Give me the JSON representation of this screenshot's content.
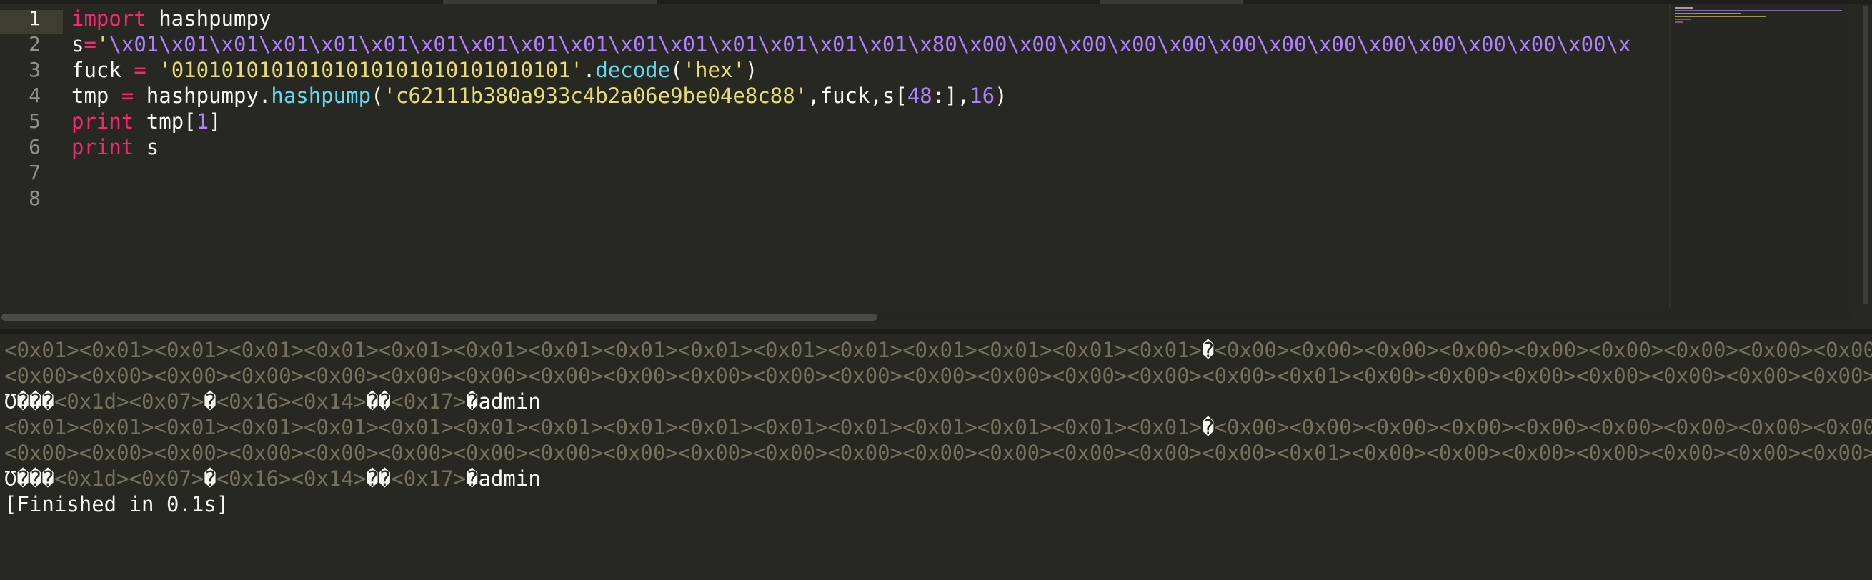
{
  "editor": {
    "line_numbers": [
      "1",
      "2",
      "3",
      "4",
      "5",
      "6",
      "7",
      "8"
    ],
    "line1": {
      "kw": "import",
      "rest": " hashpumpy"
    },
    "line2": {
      "lhs": "s",
      "eq": "=",
      "quote": "'",
      "esc": "\\x01\\x01\\x01\\x01\\x01\\x01\\x01\\x01\\x01\\x01\\x01\\x01\\x01\\x01\\x01\\x01\\x80\\x00\\x00\\x00\\x00\\x00\\x00\\x00\\x00\\x00\\x00\\x00\\x00\\x00\\x"
    },
    "line3": {
      "lhs": "fuck ",
      "eq": "=",
      "sp": " ",
      "str": "'01010101010101010101010101010101'",
      "dot": ".",
      "fn": "decode",
      "open": "(",
      "arg": "'hex'",
      "close": ")"
    },
    "line4": {
      "lhs": "tmp ",
      "eq": "=",
      "mid": " hashpumpy.",
      "fn": "hashpump",
      "open": "(",
      "arg1": "'c62111b380a933c4b2a06e9be04e8c88'",
      "sep": ",fuck,s[",
      "num1": "48",
      "sep2": ":],",
      "num2": "16",
      "close": ")"
    },
    "line5": {
      "kw": "print",
      "rest": " tmp[",
      "num": "1",
      "close": "]"
    },
    "line6": {
      "kw": "print",
      "rest": " s"
    }
  },
  "output": {
    "row1": {
      "a": "<0x01><0x01><0x01><0x01><0x01><0x01><0x01><0x01><0x01><0x01><0x01><0x01><0x01><0x01><0x01><0x01>",
      "b": "�",
      "c": "<0x00><0x00><0x00><0x00><0x00><0x00><0x00><0x00><0x00>"
    },
    "row2": {
      "a": "<0x00><0x00><0x00><0x00><0x00><0x00><0x00><0x00><0x00><0x00><0x00><0x00><0x00><0x00><0x00><0x00><0x00><0x01><0x00><0x00><0x00><0x00><0x00><0x00><0x00><0x14>",
      "b": "�"
    },
    "row3": {
      "a": "Ʊ���",
      "b": "<0x1d><0x07>",
      "c": "�",
      "d": "<0x16><0x14>",
      "e": "��",
      "f": "<0x17>",
      "g": "�",
      "h": "admin"
    },
    "row4": {
      "a": "<0x01><0x01><0x01><0x01><0x01><0x01><0x01><0x01><0x01><0x01><0x01><0x01><0x01><0x01><0x01><0x01>",
      "b": "�",
      "c": "<0x00><0x00><0x00><0x00><0x00><0x00><0x00><0x00><0x00>"
    },
    "row5": {
      "a": "<0x00><0x00><0x00><0x00><0x00><0x00><0x00><0x00><0x00><0x00><0x00><0x00><0x00><0x00><0x00><0x00><0x00><0x01><0x00><0x00><0x00><0x00><0x00><0x00><0x00><0x14>",
      "b": "�"
    },
    "row6": {
      "a": "Ʊ���",
      "b": "<0x1d><0x07>",
      "c": "�",
      "d": "<0x16><0x14>",
      "e": "��",
      "f": "<0x17>",
      "g": "�",
      "h": "admin"
    },
    "finished": "[Finished in 0.1s]"
  },
  "colors": {
    "background": "#272822",
    "keyword": "#f92672",
    "string": "#e6db74",
    "number": "#ae81ff",
    "function": "#66d9ef",
    "output_dim": "#75715e"
  }
}
